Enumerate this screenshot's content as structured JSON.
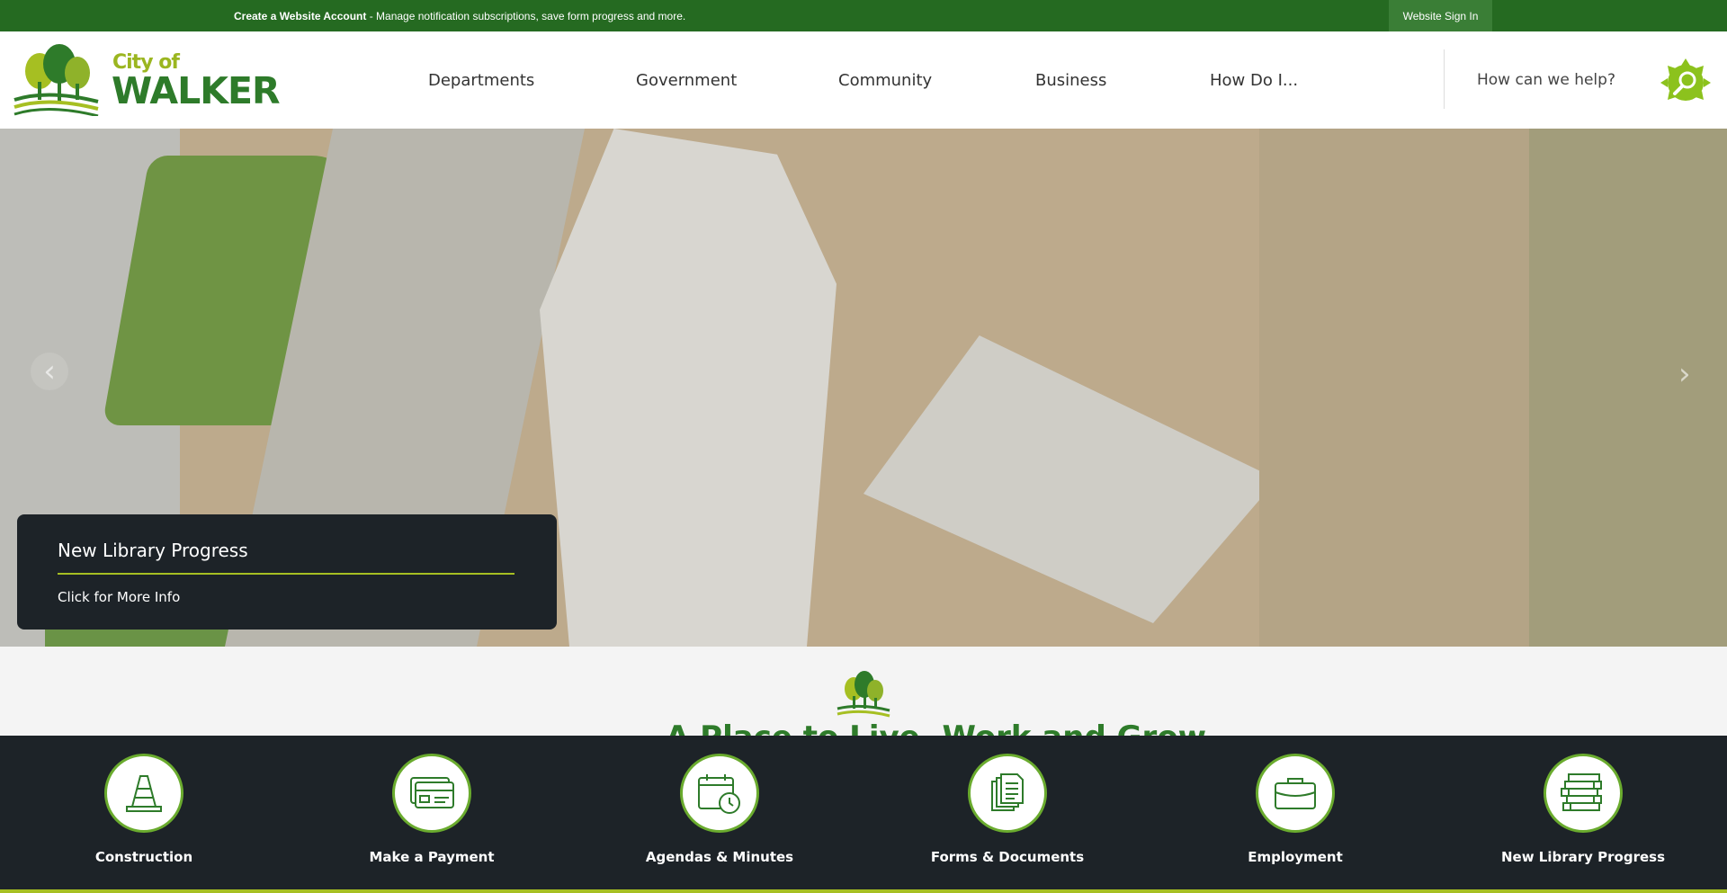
{
  "topbar": {
    "create_account": "Create a Website Account",
    "create_account_desc": " - Manage notification subscriptions, save form progress and more.",
    "signin": "Website Sign In",
    "bg_color": "#256a21"
  },
  "header": {
    "logo_small": "City of",
    "logo_big": "WALKER",
    "nav": [
      "Departments",
      "Government",
      "Community",
      "Business",
      "How Do I..."
    ],
    "search_placeholder": "How can we help?",
    "search_icon": "search-icon"
  },
  "hero": {
    "caption_title": "New Library Progress",
    "caption_sub": "Click for More Info",
    "prev_icon": "chevron-left-icon",
    "next_icon": "chevron-right-icon"
  },
  "section": {
    "heading_partial": "A Place to Live, Work and Grow"
  },
  "quick_links": [
    {
      "label": "Construction",
      "icon": "traffic-cone-icon"
    },
    {
      "label": "Make a Payment",
      "icon": "credit-card-icon"
    },
    {
      "label": "Agendas & Minutes",
      "icon": "calendar-clock-icon"
    },
    {
      "label": "Forms & Documents",
      "icon": "documents-icon"
    },
    {
      "label": "Employment",
      "icon": "briefcase-icon"
    },
    {
      "label": "New Library Progress",
      "icon": "books-icon"
    }
  ],
  "colors": {
    "primary_green": "#2e7b2a",
    "accent_lime": "#a6bf22",
    "dark_bg": "#1d2328"
  }
}
